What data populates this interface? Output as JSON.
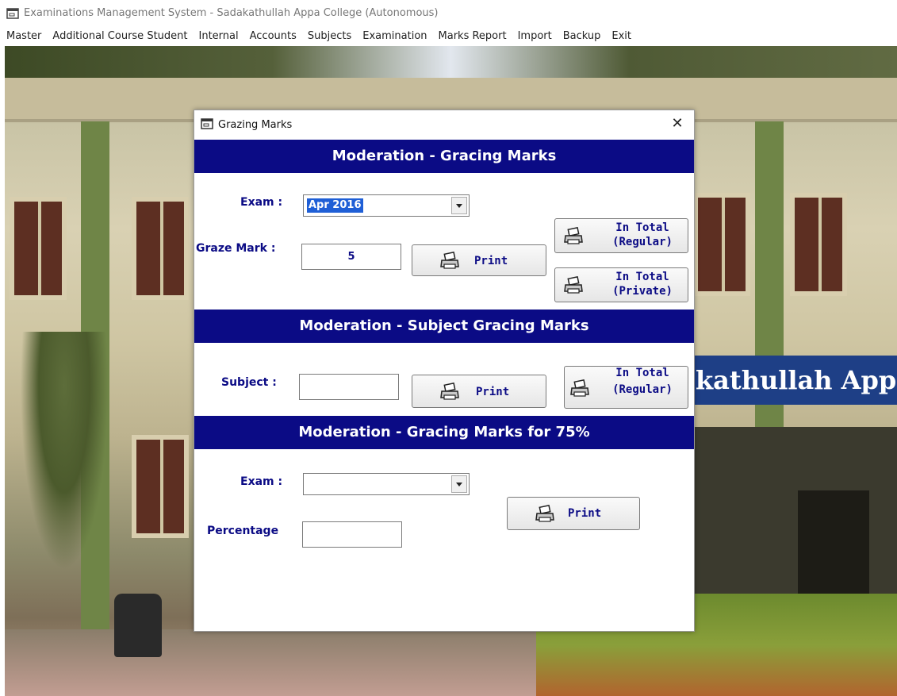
{
  "app": {
    "title": "Examinations Management System - Sadakathullah Appa College (Autonomous)",
    "menu": [
      "Master",
      "Additional Course Student",
      "Internal",
      "Accounts",
      "Subjects",
      "Examination",
      "Marks Report",
      "Import",
      "Backup",
      "Exit"
    ]
  },
  "background": {
    "banner_text": "kathullah App"
  },
  "dialog": {
    "title": "Grazing Marks",
    "close_glyph": "✕",
    "section1": {
      "header": "Moderation - Gracing Marks",
      "exam_label": "Exam :",
      "exam_value": "Apr 2016",
      "graze_label": "Graze Mark :",
      "graze_value": "5",
      "print_label": "Print",
      "in_total_regular_line1": "In Total",
      "in_total_regular_line2": "(Regular)",
      "in_total_private_line1": "In Total",
      "in_total_private_line2": "(Private)"
    },
    "section2": {
      "header": "Moderation - Subject  Gracing Marks",
      "subject_label": "Subject :",
      "subject_value": "",
      "print_label": "Print",
      "in_total_regular_line1": "In Total",
      "in_total_regular_line2": "(Regular)"
    },
    "section3": {
      "header": "Moderation - Gracing Marks for 75%",
      "exam_label": "Exam :",
      "exam_value": "",
      "percentage_label": "Percentage",
      "percentage_value": "",
      "print_label": "Print"
    }
  },
  "colors": {
    "header_bg": "#0b0b85",
    "label_text": "#0b0b85",
    "selection": "#1f5fd6"
  }
}
